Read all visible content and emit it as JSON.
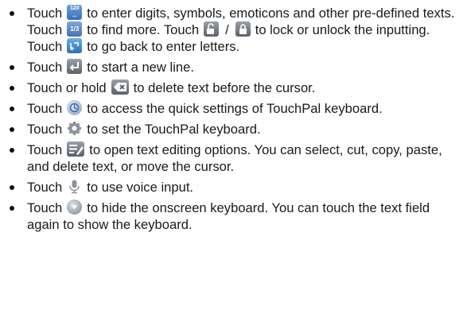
{
  "items": [
    {
      "a": "Touch",
      "icon1_label": "12#",
      "b": "to enter digits, symbols, emoticons and other pre-defined texts. Touch",
      "icon2_label": "1/3",
      "c": "to find more. Touch",
      "slash": "/",
      "d": "to lock or unlock the inputting. Touch",
      "e": "to go back to enter letters."
    },
    {
      "a": "Touch",
      "b": "to start a new line."
    },
    {
      "a": "Touch or hold",
      "b": "to delete text before the cursor."
    },
    {
      "a": "Touch",
      "b": "to access the quick settings of TouchPal keyboard."
    },
    {
      "a": "Touch",
      "b": "to set the TouchPal keyboard."
    },
    {
      "a": "Touch",
      "b": "to open text editing options. You can select, cut, copy, paste, and delete text, or move the cursor."
    },
    {
      "a": "Touch",
      "b": "to use voice input."
    },
    {
      "a": "Touch",
      "b": "to hide the onscreen keyboard. You can touch the text field again to show the keyboard."
    }
  ],
  "icons": [
    "number-symbol-key-icon",
    "page-indicator-icon",
    "unlock-icon",
    "lock-icon",
    "back-to-letters-icon",
    "enter-key-icon",
    "delete-key-icon",
    "quick-settings-icon",
    "settings-gear-icon",
    "text-edit-icon",
    "microphone-icon",
    "hide-keyboard-icon"
  ]
}
